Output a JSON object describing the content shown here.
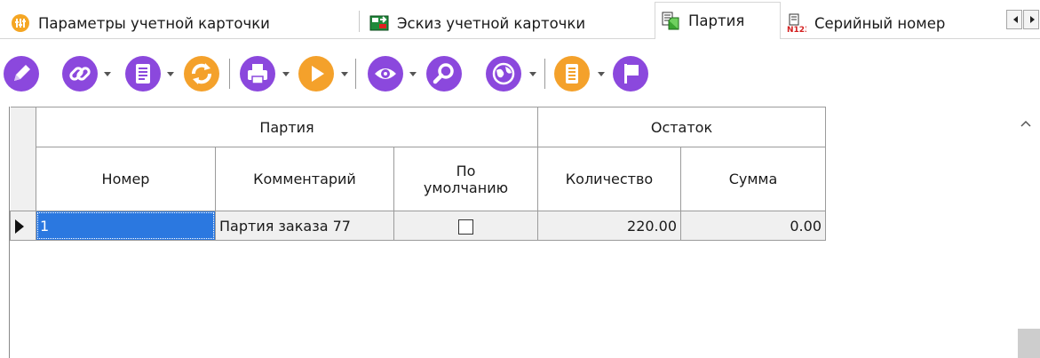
{
  "tabs": [
    {
      "label": "Параметры учетной карточки",
      "icon": "parameters-icon",
      "active": false
    },
    {
      "label": "Эскиз учетной карточки",
      "icon": "sketch-icon",
      "active": false
    },
    {
      "label": "Партия",
      "icon": "batch-icon",
      "active": true
    },
    {
      "label": "Серийный номер",
      "icon": "serial-number-icon",
      "active": false
    }
  ],
  "toolbar": {
    "buttons": [
      {
        "icon": "pencil-icon",
        "dropdown": false
      },
      {
        "icon": "link-icon",
        "dropdown": true
      },
      {
        "icon": "document-icon",
        "dropdown": true
      },
      {
        "icon": "refresh-icon",
        "dropdown": false
      },
      {
        "icon": "printer-icon",
        "dropdown": true
      },
      {
        "icon": "play-icon",
        "dropdown": true
      },
      {
        "icon": "eye-icon",
        "dropdown": true
      },
      {
        "icon": "search-icon",
        "dropdown": false
      },
      {
        "icon": "globe-icon",
        "dropdown": true
      },
      {
        "icon": "notes-icon",
        "dropdown": true
      },
      {
        "icon": "flag-icon",
        "dropdown": false
      }
    ]
  },
  "grid": {
    "group_headers": {
      "batch": "Партия",
      "balance": "Остаток"
    },
    "columns": {
      "number": "Номер",
      "comment": "Комментарий",
      "default": "По умолчанию",
      "quantity": "Количество",
      "amount": "Сумма"
    },
    "rows": [
      {
        "number": "1",
        "comment": "Партия заказа 77",
        "default": false,
        "quantity": "220.00",
        "amount": "0.00"
      }
    ]
  },
  "colors": {
    "accent": "#8b48dd",
    "orange": "#f4a12b",
    "selection": "#2b78e0"
  }
}
